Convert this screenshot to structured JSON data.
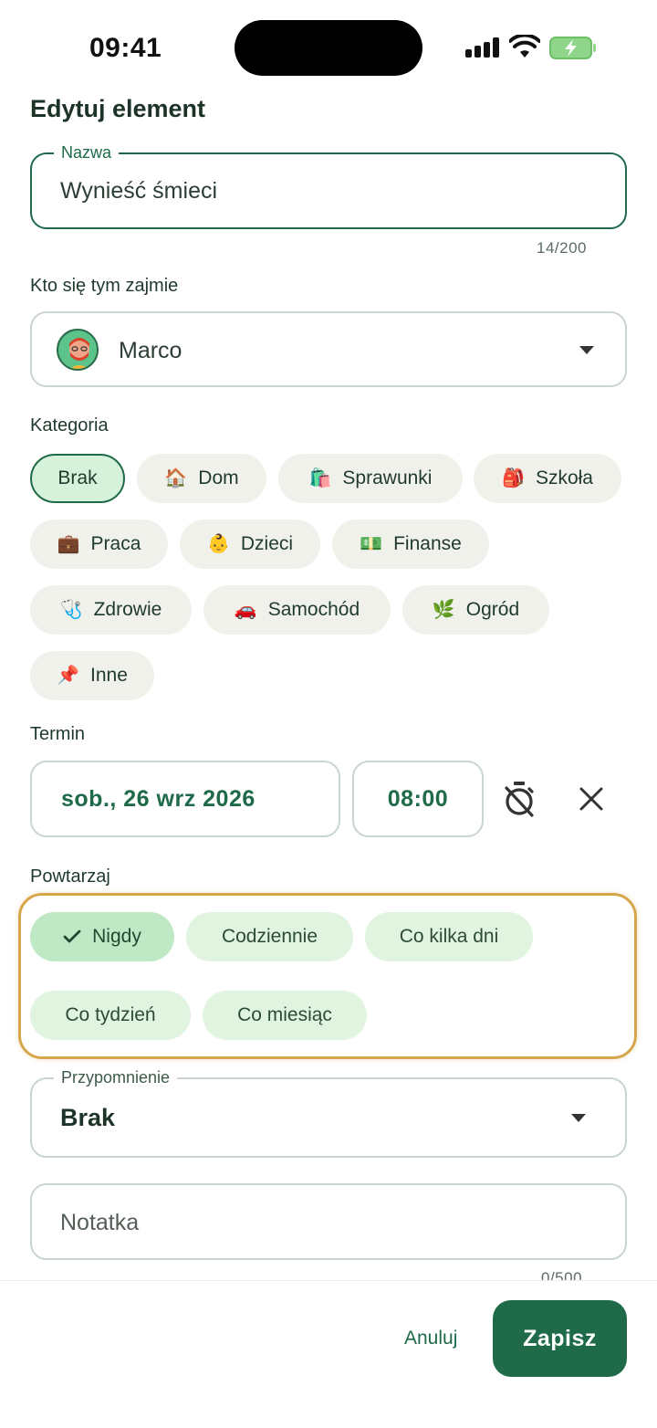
{
  "status": {
    "time": "09:41"
  },
  "title": "Edytuj element",
  "name_field": {
    "label": "Nazwa",
    "value": "Wynieść śmieci",
    "counter": "14/200"
  },
  "assignee": {
    "label": "Kto się tym zajmie",
    "value": "Marco"
  },
  "category": {
    "label": "Kategoria",
    "chips": [
      {
        "label": "Brak",
        "emoji": "",
        "selected": true
      },
      {
        "label": "Dom",
        "emoji": "🏠"
      },
      {
        "label": "Sprawunki",
        "emoji": "🛍️"
      },
      {
        "label": "Szkoła",
        "emoji": "🎒"
      },
      {
        "label": "Praca",
        "emoji": "💼"
      },
      {
        "label": "Dzieci",
        "emoji": "👶"
      },
      {
        "label": "Finanse",
        "emoji": "💵"
      },
      {
        "label": "Zdrowie",
        "emoji": "🩺"
      },
      {
        "label": "Samochód",
        "emoji": "🚗"
      },
      {
        "label": "Ogród",
        "emoji": "🌿"
      },
      {
        "label": "Inne",
        "emoji": "📌"
      }
    ]
  },
  "deadline": {
    "label": "Termin",
    "date": "sob., 26 wrz 2026",
    "time": "08:00"
  },
  "repeat": {
    "label": "Powtarzaj",
    "options": [
      {
        "label": "Nigdy",
        "selected": true
      },
      {
        "label": "Codziennie"
      },
      {
        "label": "Co kilka dni"
      },
      {
        "label": "Co tydzień"
      },
      {
        "label": "Co miesiąc"
      }
    ]
  },
  "reminder": {
    "label": "Przypomnienie",
    "value": "Brak"
  },
  "note": {
    "placeholder": "Notatka",
    "counter": "0/500"
  },
  "actions": {
    "cancel": "Anuluj",
    "save": "Zapisz"
  },
  "colors": {
    "primary": "#1e6a49",
    "highlight": "#d6a64c",
    "chip_bg": "#f1f1ec",
    "repeat_chip_bg": "#e0f4e0"
  }
}
